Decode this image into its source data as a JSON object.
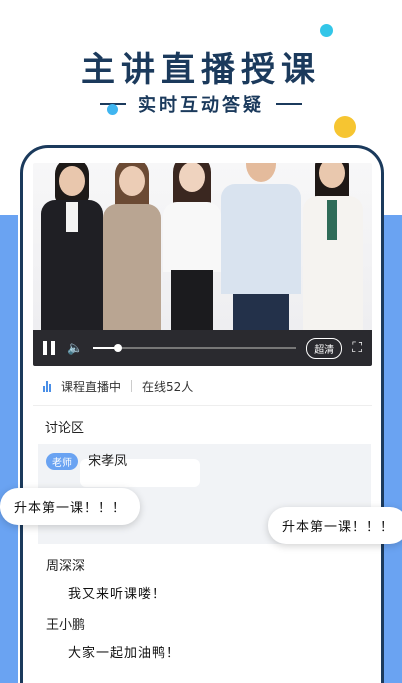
{
  "headline": "主讲直播授课",
  "subline": "实时互动答疑",
  "player": {
    "quality_label": "超清",
    "progress_fraction": 0.12,
    "icons": [
      "pause-icon",
      "volume-icon",
      "fullscreen-icon"
    ]
  },
  "status": {
    "live_label": "课程直播中",
    "online_label": "在线52人"
  },
  "discussion": {
    "title": "讨论区",
    "teacher_badge": "老师",
    "teacher_name": "宋孝凤",
    "bubble_left": "升本第一课！！！",
    "bubble_right": "升本第一课！！！",
    "messages": [
      {
        "name": "周深深",
        "text": "我又来听课喽！"
      },
      {
        "name": "王小鹏",
        "text": "大家一起加油鸭！"
      }
    ]
  },
  "colors": {
    "navy": "#1b3a5c",
    "accent_blue": "#6aa3f2",
    "cyan": "#33c6e8",
    "yellow": "#f6c531"
  }
}
